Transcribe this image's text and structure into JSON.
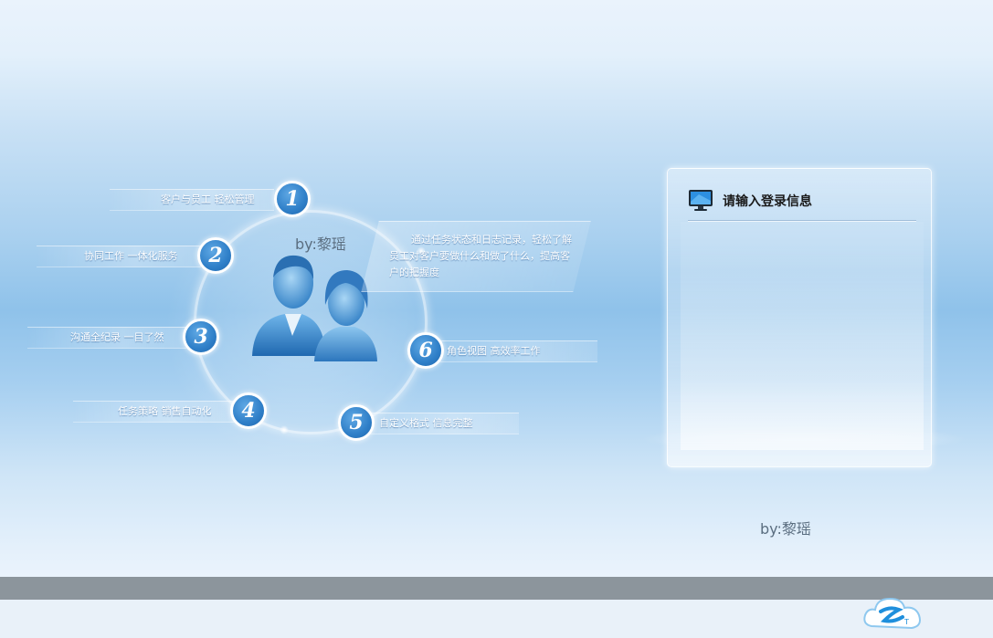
{
  "features": [
    {
      "num": "1",
      "label": "客户与员工  轻松管理"
    },
    {
      "num": "2",
      "label": "协同工作  一体化服务"
    },
    {
      "num": "3",
      "label": "沟通全纪录  一目了然"
    },
    {
      "num": "4",
      "label": "任务策略  销售自动化"
    },
    {
      "num": "5",
      "label": "自定义格式  信息完整"
    },
    {
      "num": "6",
      "label": "角色视图  高效率工作"
    }
  ],
  "byline_top": "by:黎瑶",
  "byline_bottom": "by:黎瑶",
  "callout": "通过任务状态和日志记录，轻松了解员工对客户要做什么和做了什么，提高客户的把握度",
  "login": {
    "title": "请输入登录信息",
    "icon": "monitor-icon"
  },
  "colors": {
    "accent_blue": "#2f7fc8",
    "footer_bar": "#8c959c"
  }
}
